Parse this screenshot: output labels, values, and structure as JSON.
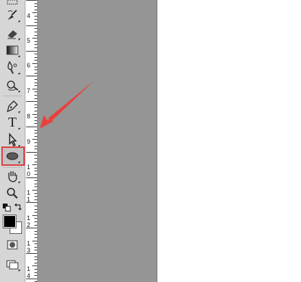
{
  "toolbar": {
    "tools": [
      {
        "name": "rectangular-marquee-icon",
        "selected": false
      },
      {
        "name": "history-brush-icon",
        "selected": false
      },
      {
        "name": "eraser-icon",
        "selected": false
      },
      {
        "name": "gradient-icon",
        "selected": false
      },
      {
        "name": "blur-icon",
        "selected": false
      },
      {
        "name": "dodge-icon",
        "selected": false
      },
      {
        "name": "pen-icon",
        "selected": false
      },
      {
        "name": "type-icon",
        "selected": false
      },
      {
        "name": "path-selection-icon",
        "selected": false
      },
      {
        "name": "ellipse-shape-icon",
        "selected": true
      },
      {
        "name": "hand-icon",
        "selected": false
      },
      {
        "name": "zoom-icon",
        "selected": false
      },
      {
        "name": "quick-mask-icon",
        "selected": false
      },
      {
        "name": "screen-mode-icon",
        "selected": false
      }
    ],
    "type_glyph": "T",
    "foreground_color": "#000000",
    "background_color": "#ffffff"
  },
  "ruler": {
    "labels": [
      "4",
      "5",
      "6",
      "7",
      "8",
      "9",
      "1",
      "0",
      "1",
      "1",
      "1",
      "2",
      "1",
      "3",
      "1",
      "4"
    ]
  },
  "colors": {
    "highlight": "#e03a3a",
    "arrow": "#e8413c",
    "canvas": "#959595",
    "toolbar": "#d6d6d6"
  }
}
